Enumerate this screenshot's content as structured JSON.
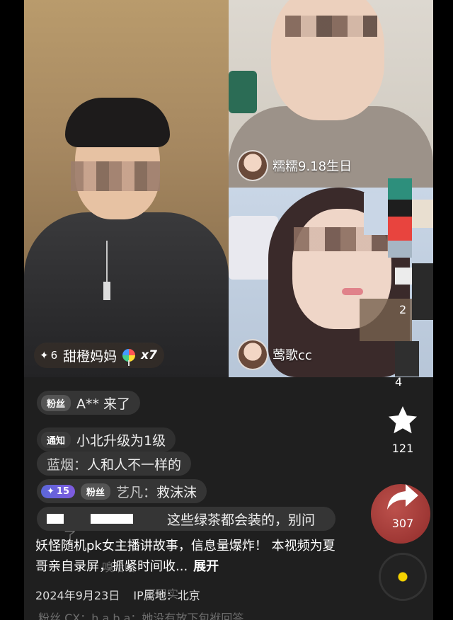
{
  "stream": {
    "host": {
      "level": "6",
      "name": "甜橙妈妈",
      "gift_count": "x7"
    },
    "guests": [
      {
        "name": "糯糯9.18生日"
      },
      {
        "name": "莺歌cc"
      }
    ]
  },
  "comments": [
    {
      "badge": "粉丝",
      "text": "A** 来了"
    },
    {
      "badge": "通知",
      "text": "小北升级为1级"
    },
    {
      "user": "蓝烟：",
      "text": "人和人不一样的"
    },
    {
      "level": "15",
      "badge": "粉丝",
      "user": "艺凡：",
      "text": "救沫沫"
    },
    {
      "text": "这些绿茶都会装的，别问"
    }
  ],
  "ghost_texts": {
    "tail_char": "了",
    "under_desc": "嗅哈哈",
    "under_meta": "不现实",
    "bottom_row": "粉丝  CX：h a b a：她没有放下包袱回答"
  },
  "description": {
    "text": "妖怪随机pk女主播讲故事，信息量爆炸！ 本视频为夏哥亲自录屏，抓紧时间收...",
    "expand_label": "展开"
  },
  "meta": {
    "date": "2024年9月23日",
    "location": "IP属地：北京"
  },
  "rail": {
    "partial_count_top": "2",
    "partial_count_mid": "4",
    "star_count": "121",
    "share_count": "307"
  },
  "icons": [
    "star-icon",
    "share-icon",
    "music-disc-icon",
    "sparkle-icon",
    "lollipop-icon"
  ]
}
